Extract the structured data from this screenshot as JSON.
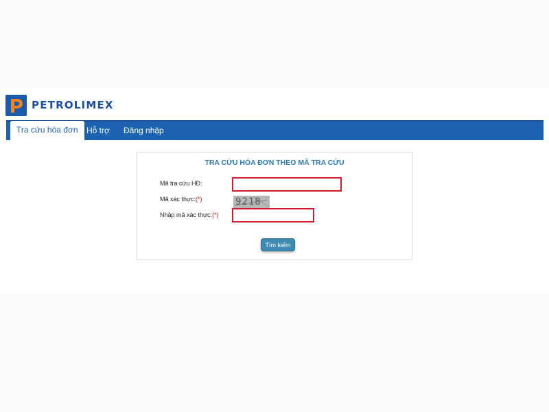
{
  "brand": {
    "name": "PETROLIMEX",
    "accent": "#1b63b0",
    "logo_orange": "#f58220"
  },
  "nav": {
    "tabs": [
      {
        "label": "Tra cứu hóa đơn",
        "active": true
      },
      {
        "label": "Hỗ trợ",
        "active": false
      },
      {
        "label": "Đăng nhập",
        "active": false
      }
    ]
  },
  "form": {
    "title": "TRA CỨU HÓA ĐƠN THEO MÃ TRA CỨU",
    "invoice_code_label": "Mã tra cứu HĐ:",
    "invoice_code_value": "",
    "captcha_label": "Mã xác thực:",
    "required_mark": "(*)",
    "captcha_text": "9218",
    "captcha_input_label": "Nhập mã xác thực:",
    "captcha_input_value": "",
    "search_button": "Tìm kiếm"
  }
}
